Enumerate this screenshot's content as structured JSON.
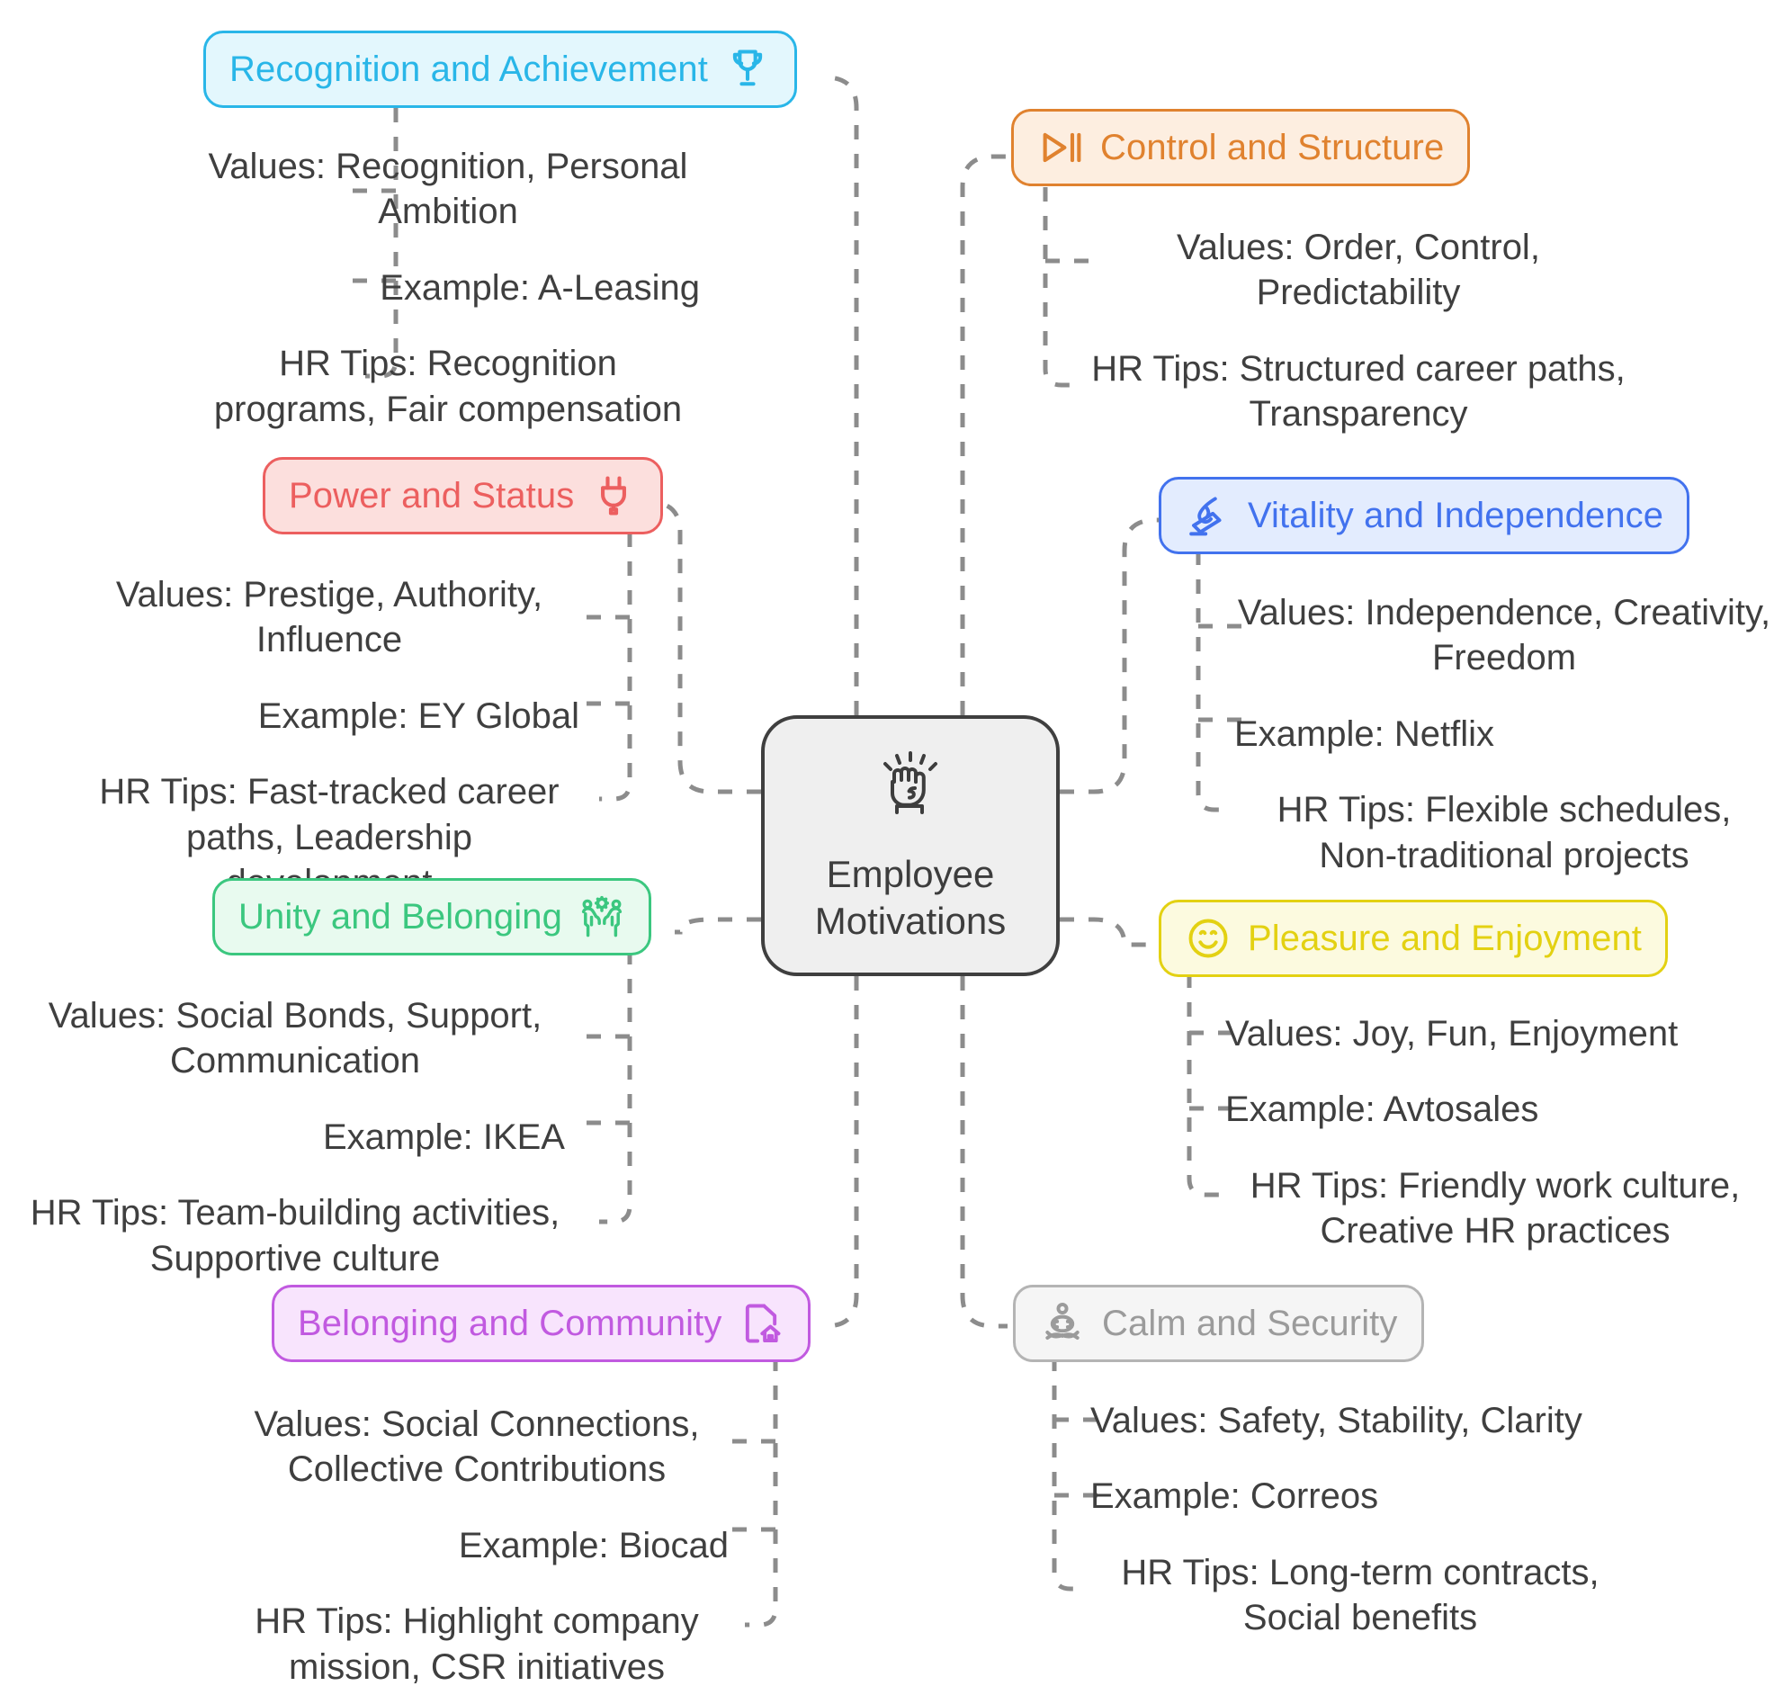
{
  "diagram": {
    "type": "mind-map",
    "center": {
      "title_line1": "Employee",
      "title_line2": "Motivations",
      "icon": "raised-fist-icon",
      "border_color": "#3f3f3f",
      "fill_color": "#efefef"
    },
    "branches": [
      {
        "id": "recognition-and-achievement",
        "label": "Recognition and Achievement",
        "icon": "trophy-icon",
        "icon_side": "right",
        "color": "#29b6e8",
        "fill": "#e3f7fd",
        "side": "left",
        "details": [
          "Values: Recognition, Personal Ambition",
          "Example: A-Leasing",
          "HR Tips: Recognition programs, Fair compensation"
        ]
      },
      {
        "id": "power-and-status",
        "label": "Power and Status",
        "icon": "power-plug-icon",
        "icon_side": "right",
        "color": "#ec5f5f",
        "fill": "#fcdfdd",
        "side": "left",
        "details": [
          "Values: Prestige, Authority, Influence",
          "Example: EY Global",
          "HR Tips: Fast-tracked career paths, Leadership development"
        ]
      },
      {
        "id": "unity-and-belonging",
        "label": "Unity and Belonging",
        "icon": "teamwork-people-icon",
        "icon_side": "right",
        "color": "#3bc77f",
        "fill": "#e8faef",
        "side": "left",
        "details": [
          "Values: Social Bonds, Support, Communication",
          "Example: IKEA",
          "HR Tips: Team-building activities, Supportive culture"
        ]
      },
      {
        "id": "belonging-and-community",
        "label": "Belonging and Community",
        "icon": "document-home-icon",
        "icon_side": "right",
        "color": "#c15ae0",
        "fill": "#f8e4fd",
        "side": "left",
        "details": [
          "Values: Social Connections, Collective Contributions",
          "Example: Biocad",
          "HR Tips: Highlight company mission, CSR initiatives"
        ]
      },
      {
        "id": "control-and-structure",
        "label": "Control and Structure",
        "icon": "play-pause-icon",
        "icon_side": "left",
        "color": "#e0822f",
        "fill": "#fdeee0",
        "side": "right",
        "details": [
          "Values: Order, Control, Predictability",
          "HR Tips: Structured career paths, Transparency"
        ]
      },
      {
        "id": "vitality-and-independence",
        "label": "Vitality and Independence",
        "icon": "torch-flame-icon",
        "icon_side": "left",
        "color": "#4272ee",
        "fill": "#e3ecfe",
        "side": "right",
        "details": [
          "Values: Independence, Creativity, Freedom",
          "Example: Netflix",
          "HR Tips: Flexible schedules, Non-traditional projects"
        ]
      },
      {
        "id": "pleasure-and-enjoyment",
        "label": "Pleasure and Enjoyment",
        "icon": "smiley-face-icon",
        "icon_side": "left",
        "color": "#e3d112",
        "fill": "#fcfadf",
        "side": "right",
        "details": [
          "Values: Joy, Fun, Enjoyment",
          "Example: Avtosales",
          "HR Tips: Friendly work culture, Creative HR practices"
        ]
      },
      {
        "id": "calm-and-security",
        "label": "Calm and Security",
        "icon": "meditation-lotus-icon",
        "icon_side": "left",
        "color": "#9b9b9b",
        "fill": "#f5f5f5",
        "side": "right",
        "details": [
          "Values: Safety, Stability, Clarity",
          "Example: Correos",
          "HR Tips: Long-term contracts, Social benefits"
        ]
      }
    ],
    "edge_color": "#8c8c8c"
  }
}
